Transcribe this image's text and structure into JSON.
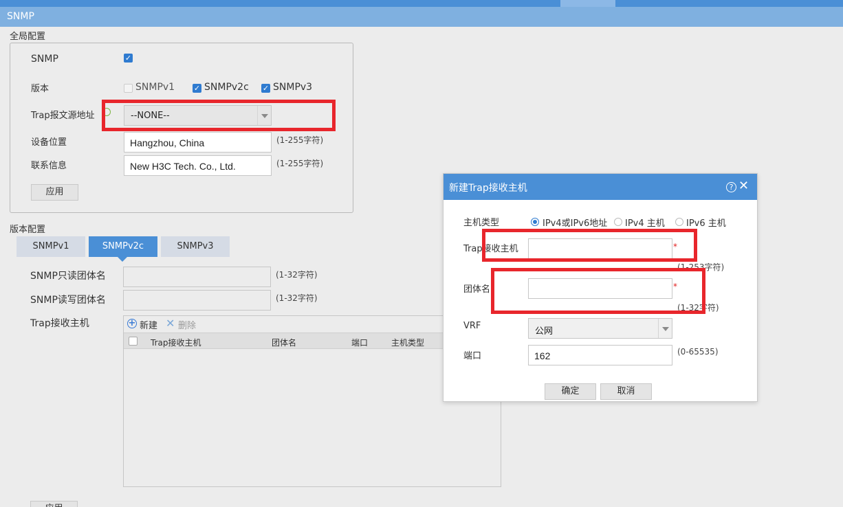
{
  "window": {
    "title": "SNMP"
  },
  "global": {
    "section_title": "全局配置",
    "snmp_label": "SNMP",
    "version_label": "版本",
    "versions": [
      "SNMPv1",
      "SNMPv2c",
      "SNMPv3"
    ],
    "versions_checked": [
      false,
      true,
      true
    ],
    "trap_source_label": "Trap报文源地址",
    "trap_source_value": "--NONE--",
    "location_label": "设备位置",
    "location_value": "Hangzhou, China",
    "location_hint": "(1-255字符)",
    "contact_label": "联系信息",
    "contact_value": "New H3C Tech. Co., Ltd.",
    "contact_hint": "(1-255字符)",
    "apply_label": "应用"
  },
  "version_config": {
    "section_title": "版本配置",
    "tabs": [
      "SNMPv1",
      "SNMPv2c",
      "SNMPv3"
    ],
    "active_tab": "SNMPv2c",
    "ro_community_label": "SNMP只读团体名",
    "ro_hint": "(1-32字符)",
    "rw_community_label": "SNMP读写团体名",
    "rw_hint": "(1-32字符)",
    "trap_host_label": "Trap接收主机",
    "toolbar": {
      "new_label": "新建",
      "delete_label": "删除"
    },
    "columns": [
      "Trap接收主机",
      "团体名",
      "端口",
      "主机类型"
    ],
    "apply_label": "应用"
  },
  "dialog": {
    "title": "新建Trap接收主机",
    "host_type_label": "主机类型",
    "host_type_options": [
      "IPv4或IPv6地址",
      "IPv4 主机",
      "IPv6 主机"
    ],
    "host_type_selected": "IPv4或IPv6地址",
    "trap_host_label": "Trap接收主机",
    "trap_host_value": "",
    "trap_host_hint": "(1-253字符)",
    "community_label": "团体名",
    "community_value": "",
    "community_hint": "(1-32字符)",
    "vrf_label": "VRF",
    "vrf_value": "公网",
    "port_label": "端口",
    "port_value": "162",
    "port_hint": "(0-65535)",
    "required_mark": "*",
    "ok_label": "确定",
    "cancel_label": "取消"
  },
  "colors": {
    "accent": "#4a8fd6",
    "highlight": "#e8262c"
  }
}
